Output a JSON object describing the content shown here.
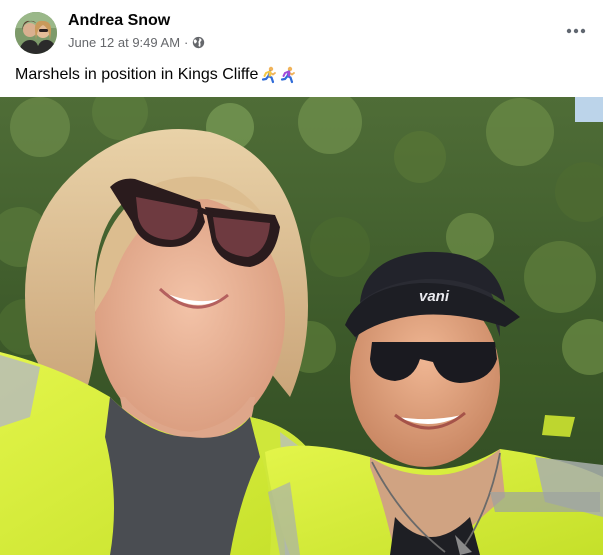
{
  "post": {
    "author_name": "Andrea Snow",
    "timestamp": "June 12 at 9:49 AM",
    "separator": "·",
    "privacy_icon": "globe-icon",
    "more_icon": "more-options-icon",
    "caption_text": "Marshels in position in Kings Cliffe",
    "caption_emoji": [
      "person-running-emoji",
      "person-running-emoji"
    ],
    "cap_lettering": "vani"
  },
  "colors": {
    "text_primary": "#050505",
    "text_secondary": "#65676b",
    "hi_vis_yellow": "#d7f23a",
    "foliage": "#3e5a2c"
  }
}
